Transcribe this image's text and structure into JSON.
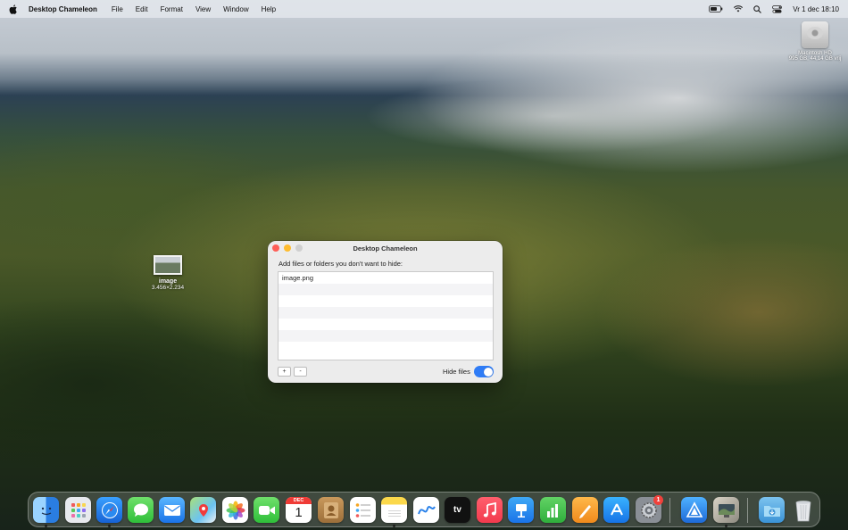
{
  "menubar": {
    "app_name": "Desktop Chameleon",
    "menus": [
      "File",
      "Edit",
      "Format",
      "View",
      "Window",
      "Help"
    ],
    "clock": "Vr 1 dec  18:10"
  },
  "desktop": {
    "disk": {
      "name": "Macintosh HD",
      "info": "995 GB, 44,14 GB vrij"
    },
    "file": {
      "name": "image",
      "dimensions": "3.456×2.234"
    }
  },
  "window": {
    "title": "Desktop Chameleon",
    "instructions": "Add files or folders you don't want to hide:",
    "files": [
      "image.png"
    ],
    "add_label": "+",
    "remove_label": "-",
    "hide_files_label": "Hide files",
    "hide_files_on": true
  },
  "dock": {
    "calendar_month": "DEC",
    "calendar_day": "1",
    "tv_label": "tv",
    "settings_badge": "1"
  },
  "colors": {
    "accent": "#2f7cf6",
    "close": "#fe5f57",
    "minimize": "#febc2e"
  }
}
